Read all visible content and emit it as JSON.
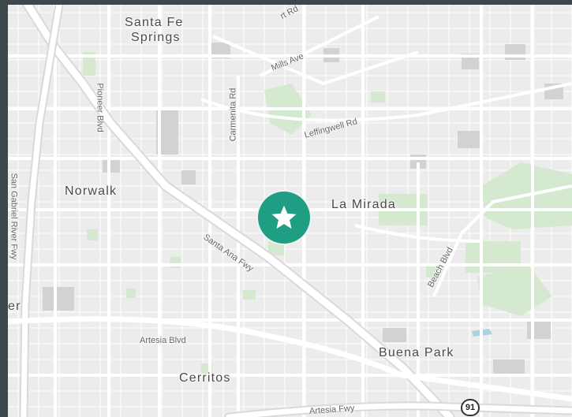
{
  "map": {
    "cities": {
      "santa_fe_springs_line1": "Santa Fe",
      "santa_fe_springs_line2": "Springs",
      "norwalk": "Norwalk",
      "la_mirada": "La Mirada",
      "buena_park": "Buena Park",
      "cerritos": "Cerritos",
      "edge_fragment": "er"
    },
    "roads": {
      "telegraph_fragment": "rt Rd",
      "mills_ave": "Mills Ave",
      "pioneer_blvd": "Pioneer Blvd",
      "carmenita_rd": "Carmenita Rd",
      "leffingwell_rd": "Leffingwell Rd",
      "san_gabriel_river_fwy": "San Gabriel River Fwy",
      "santa_ana_fwy": "Santa Ana Fwy",
      "beach_blvd": "Beach Blvd",
      "artesia_blvd": "Artesia Blvd",
      "artesia_fwy": "Artesia Fwy"
    },
    "highway_shield": "91",
    "marker_icon": "star-icon",
    "colors": {
      "background": "#ececec",
      "park": "#d4e9cf",
      "building": "#d2d2d2",
      "road": "#ffffff",
      "marker": "#1f9e83",
      "frame": "#3c474c"
    }
  }
}
